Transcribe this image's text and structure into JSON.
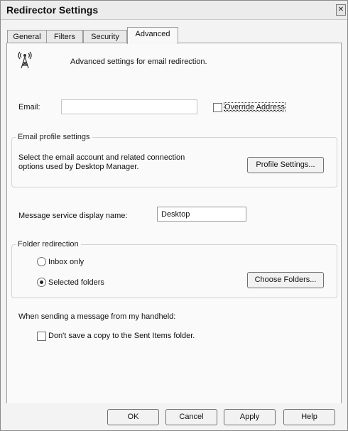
{
  "window": {
    "title": "Redirector Settings",
    "close_glyph": "✕"
  },
  "tabs": [
    {
      "label": "General"
    },
    {
      "label": "Filters"
    },
    {
      "label": "Security"
    },
    {
      "label": "Advanced",
      "active": true
    }
  ],
  "header": {
    "icon": "wireless-tower-icon",
    "description": "Advanced settings for email redirection."
  },
  "email": {
    "label": "Email:",
    "value": "",
    "override_label": "Override Address",
    "override_checked": false
  },
  "profile_group": {
    "legend": "Email profile settings",
    "description_line1": "Select the email account and related connection",
    "description_line2": "options used by Desktop Manager.",
    "button_label": "Profile Settings..."
  },
  "display_name": {
    "label": "Message service display name:",
    "value": "Desktop"
  },
  "folder_group": {
    "legend": "Folder redirection",
    "options": [
      {
        "label": "Inbox only",
        "selected": false
      },
      {
        "label": "Selected folders",
        "selected": true
      }
    ],
    "button_label": "Choose Folders..."
  },
  "handheld": {
    "heading": "When sending a message from my handheld:",
    "checkbox_label": "Don't save a copy to the Sent Items folder.",
    "checked": false
  },
  "footer_buttons": {
    "ok": "OK",
    "cancel": "Cancel",
    "apply": "Apply",
    "help": "Help"
  }
}
